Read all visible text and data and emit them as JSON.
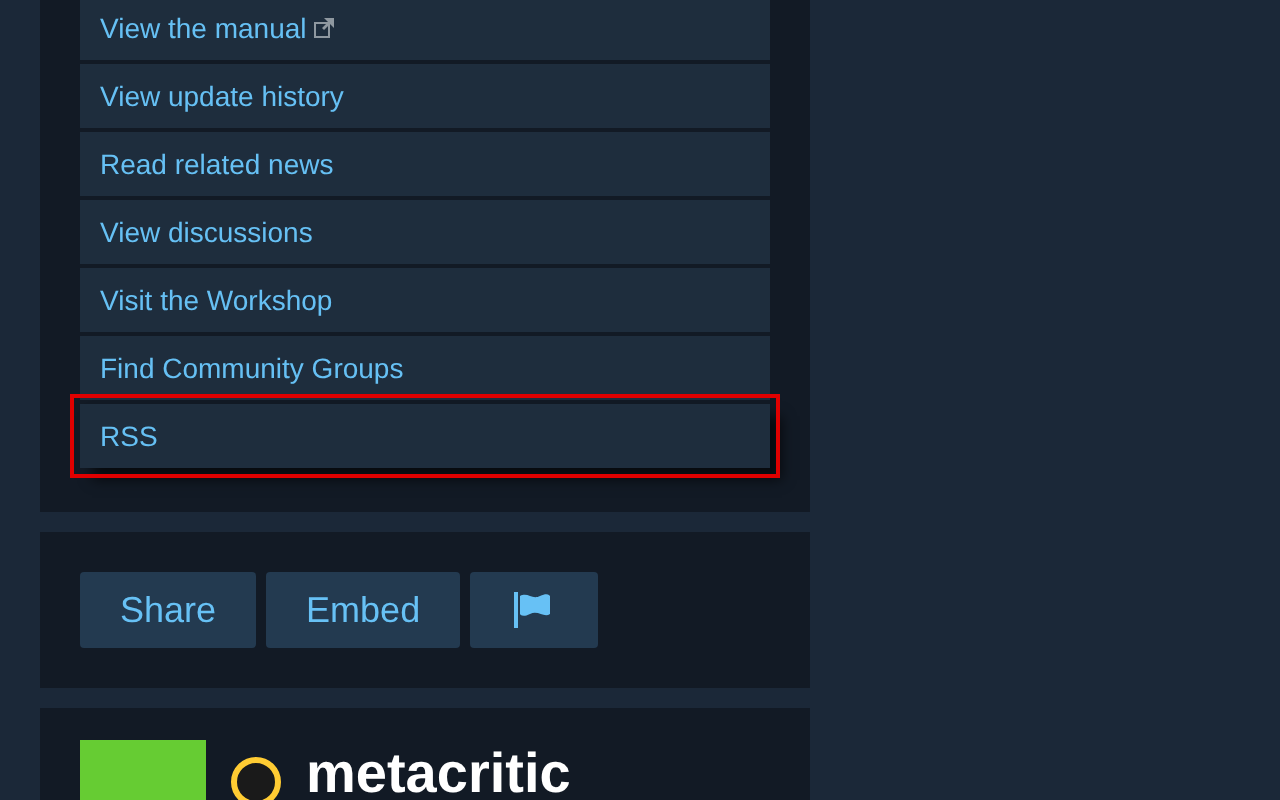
{
  "links": [
    {
      "label": "View the manual",
      "external": true,
      "highlighted": false
    },
    {
      "label": "View update history",
      "external": false,
      "highlighted": false
    },
    {
      "label": "Read related news",
      "external": false,
      "highlighted": false
    },
    {
      "label": "View discussions",
      "external": false,
      "highlighted": false
    },
    {
      "label": "Visit the Workshop",
      "external": false,
      "highlighted": false
    },
    {
      "label": "Find Community Groups",
      "external": false,
      "highlighted": false
    },
    {
      "label": "RSS",
      "external": false,
      "highlighted": true
    }
  ],
  "share_buttons": [
    {
      "kind": "text",
      "label": "Share"
    },
    {
      "kind": "text",
      "label": "Embed"
    },
    {
      "kind": "flag"
    }
  ],
  "review": {
    "logo_text": "metacritic"
  }
}
